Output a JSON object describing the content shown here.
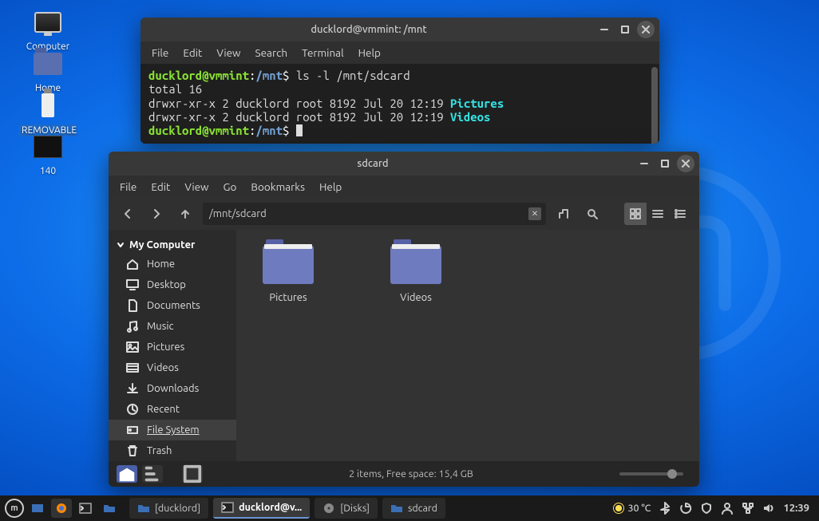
{
  "desktop": {
    "icons": [
      {
        "label": "Computer"
      },
      {
        "label": "Home"
      },
      {
        "label": "REMOVABLE"
      },
      {
        "label": "140"
      }
    ]
  },
  "terminal": {
    "title": "ducklord@vmmint: /mnt",
    "menu": [
      "File",
      "Edit",
      "View",
      "Search",
      "Terminal",
      "Help"
    ],
    "prompt_user": "ducklord@vmmint",
    "prompt_path": "/mnt",
    "command": "ls -l /mnt/sdcard",
    "output_total": "total 16",
    "rows": [
      {
        "perm": "drwxr-xr-x 2 ducklord root 8192 Jul 20 12:19 ",
        "name": "Pictures"
      },
      {
        "perm": "drwxr-xr-x 2 ducklord root 8192 Jul 20 12:19 ",
        "name": "Videos"
      }
    ]
  },
  "filemgr": {
    "title": "sdcard",
    "menu": [
      "File",
      "Edit",
      "View",
      "Go",
      "Bookmarks",
      "Help"
    ],
    "path": "/mnt/sdcard",
    "sidebar_header": "My Computer",
    "sidebar": [
      {
        "label": "Home",
        "icon": "home"
      },
      {
        "label": "Desktop",
        "icon": "desktop"
      },
      {
        "label": "Documents",
        "icon": "doc"
      },
      {
        "label": "Music",
        "icon": "music"
      },
      {
        "label": "Pictures",
        "icon": "pic"
      },
      {
        "label": "Videos",
        "icon": "vid"
      },
      {
        "label": "Downloads",
        "icon": "dl"
      },
      {
        "label": "Recent",
        "icon": "recent"
      },
      {
        "label": "File System",
        "icon": "fs",
        "active": true
      },
      {
        "label": "Trash",
        "icon": "trash"
      }
    ],
    "items": [
      {
        "label": "Pictures"
      },
      {
        "label": "Videos"
      }
    ],
    "status": "2 items, Free space: 15,4 GB"
  },
  "panel": {
    "tasks": [
      {
        "label": "[ducklord]",
        "icon": "folder"
      },
      {
        "label": "ducklord@v...",
        "icon": "term",
        "active": true
      },
      {
        "label": "[Disks]",
        "icon": "disks"
      },
      {
        "label": "sdcard",
        "icon": "folder"
      }
    ],
    "temp": "30 °C",
    "clock": "12:39"
  }
}
